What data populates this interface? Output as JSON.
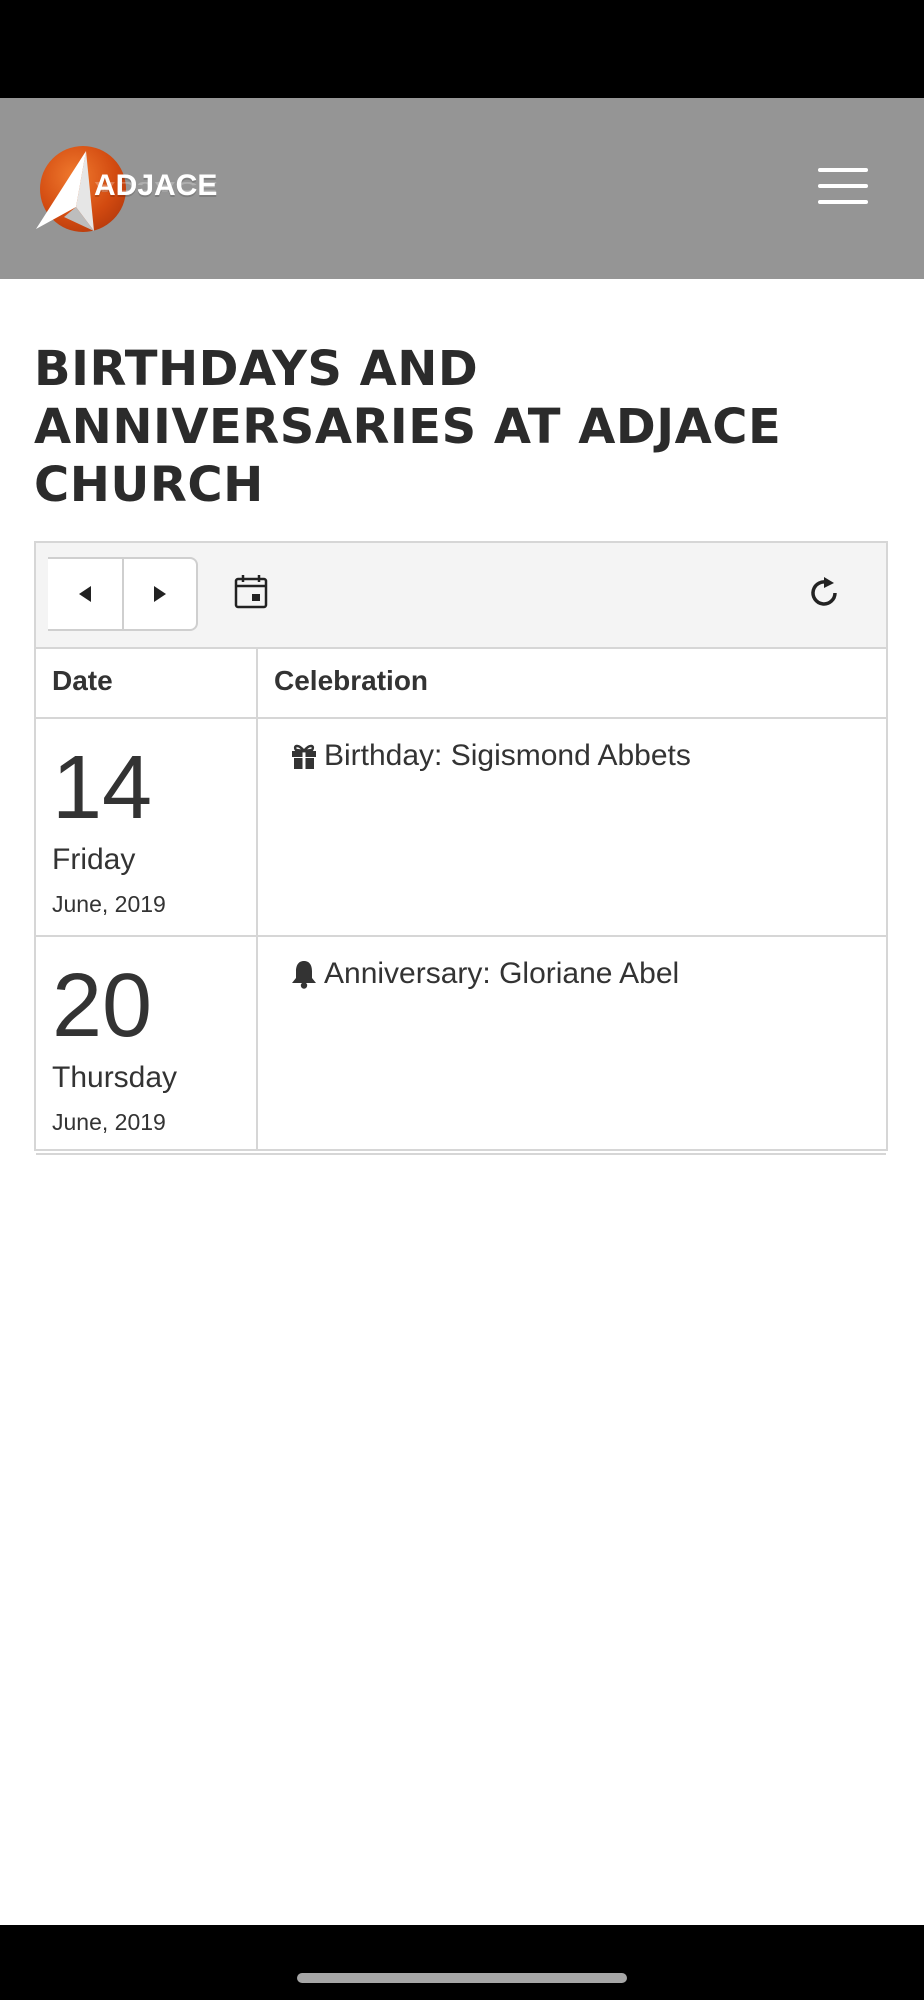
{
  "header": {
    "logo_text": "ADJACE",
    "menu_icon": "hamburger-menu-icon",
    "background_color": "#959595"
  },
  "page": {
    "title": "BIRTHDAYS AND ANNIVERSARIES AT ADJACE CHURCH"
  },
  "calendar": {
    "toolbar": {
      "prev_icon": "caret-left-icon",
      "next_icon": "caret-right-icon",
      "date_picker_icon": "calendar-icon",
      "refresh_icon": "refresh-icon"
    },
    "columns": [
      "Date",
      "Celebration"
    ],
    "rows": [
      {
        "day": "14",
        "weekday": "Friday",
        "month_year": "June, 2019",
        "icon": "gift-icon",
        "celebration": "Birthday: Sigismond Abbets"
      },
      {
        "day": "20",
        "weekday": "Thursday",
        "month_year": "June, 2019",
        "icon": "bell-icon",
        "celebration": "Anniversary: Gloriane Abel"
      }
    ]
  }
}
